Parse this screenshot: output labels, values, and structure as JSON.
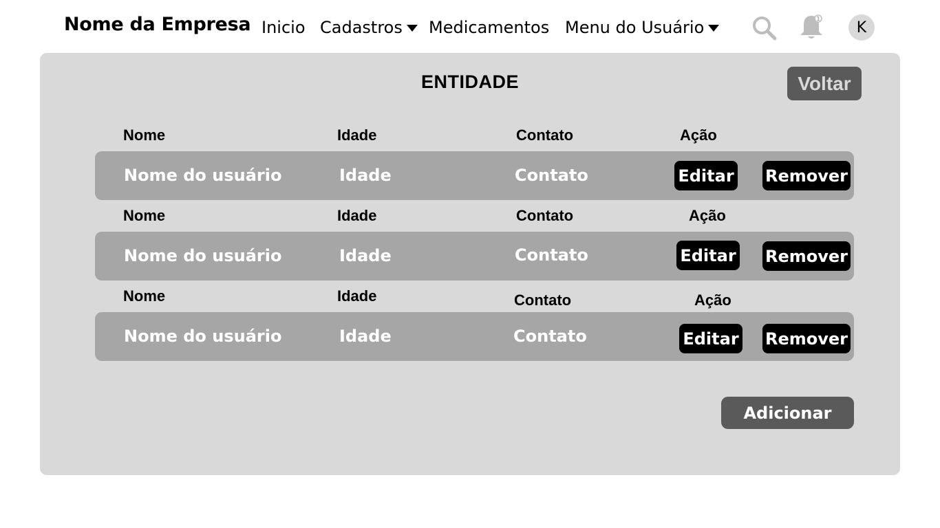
{
  "nav": {
    "brand": "Nome da Empresa",
    "inicio": "Inicio",
    "cadastros": "Cadastros",
    "medicamentos": "Medicamentos",
    "menu_usuario": "Menu do Usuário",
    "avatar_initial": "K",
    "notification_count": "1"
  },
  "page": {
    "title": "ENTIDADE",
    "back_label": "Voltar",
    "add_label": "Adicionar"
  },
  "table": {
    "groups": [
      {
        "headers": {
          "nome": "Nome",
          "idade": "Idade",
          "contato": "Contato",
          "acao": "Ação"
        },
        "row": {
          "nome": "Nome do usuário",
          "idade": "Idade",
          "contato": "Contato",
          "edit": "Editar",
          "remove": "Remover"
        }
      },
      {
        "headers": {
          "nome": "Nome",
          "idade": "Idade",
          "contato": "Contato",
          "acao": "Ação"
        },
        "row": {
          "nome": "Nome do usuário",
          "idade": "Idade",
          "contato": "Contato",
          "edit": "Editar",
          "remove": "Remover"
        }
      },
      {
        "headers": {
          "nome": "Nome",
          "idade": "Idade",
          "contato": "Contato",
          "acao": "Ação"
        },
        "row": {
          "nome": "Nome do usuário",
          "idade": "Idade",
          "contato": "Contato",
          "edit": "Editar",
          "remove": "Remover"
        }
      }
    ]
  },
  "colors": {
    "card_bg": "#d9d9d9",
    "row_bg": "#a6a6a6",
    "dark_button": "#5a5a5a",
    "black_button": "#000000"
  }
}
